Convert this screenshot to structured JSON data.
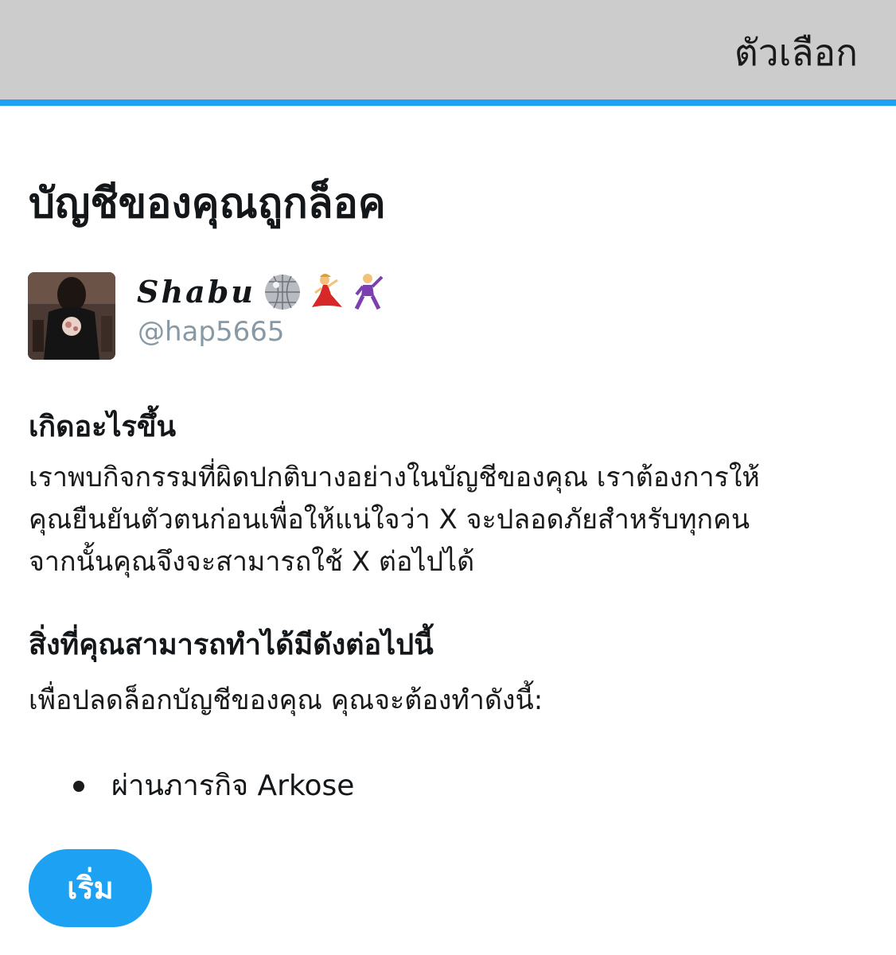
{
  "header": {
    "options_label": "ตัวเลือก",
    "accent_color": "#1da1f2",
    "background_color": "#cccccc"
  },
  "page_title": "บัญชีของคุณถูกล็อค",
  "account": {
    "display_name": "Shabu",
    "emojis": [
      "mirror-ball-icon",
      "dancer-icon",
      "man-dancing-icon"
    ],
    "handle": "@hap5665"
  },
  "what_happened": {
    "heading": "เกิดอะไรขึ้น",
    "lines": [
      "เราพบกิจกรรมที่ผิดปกติบางอย่างในบัญชีของคุณ เราต้องการให้",
      "คุณยืนยันตัวตนก่อนเพื่อให้แน่ใจว่า X จะปลอดภัยสำหรับทุกคน",
      "จากนั้นคุณจึงจะสามารถใช้ X ต่อไปได้"
    ]
  },
  "what_you_can_do": {
    "heading": "สิ่งที่คุณสามารถทำได้มีดังต่อไปนี้",
    "intro": "เพื่อปลดล็อกบัญชีของคุณ คุณจะต้องทำดังนี้:",
    "steps": [
      "ผ่านภารกิจ Arkose"
    ]
  },
  "start_button": {
    "label": "เริ่ม",
    "color": "#1da1f2"
  }
}
